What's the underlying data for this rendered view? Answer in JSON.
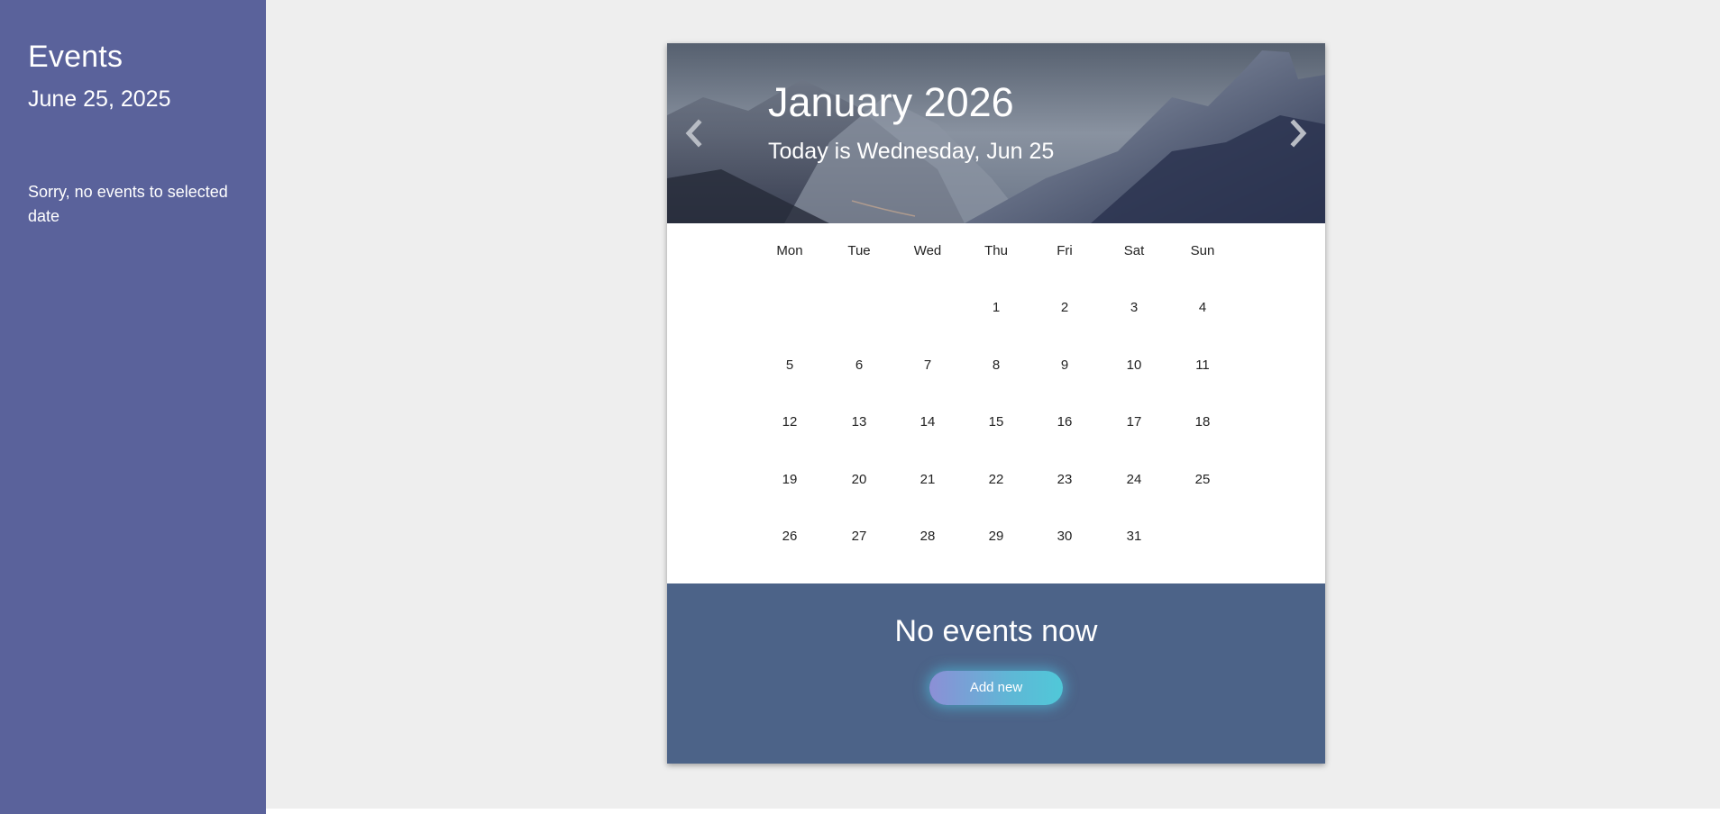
{
  "sidebar": {
    "title": "Events",
    "date": "June 25, 2025",
    "message": "Sorry, no events to selected date"
  },
  "calendar": {
    "month_title": "January 2026",
    "today_text": "Today is Wednesday, Jun 25",
    "weekdays": [
      "Mon",
      "Tue",
      "Wed",
      "Thu",
      "Fri",
      "Sat",
      "Sun"
    ],
    "weeks": [
      [
        "",
        "",
        "",
        "1",
        "2",
        "3",
        "4"
      ],
      [
        "5",
        "6",
        "7",
        "8",
        "9",
        "10",
        "11"
      ],
      [
        "12",
        "13",
        "14",
        "15",
        "16",
        "17",
        "18"
      ],
      [
        "19",
        "20",
        "21",
        "22",
        "23",
        "24",
        "25"
      ],
      [
        "26",
        "27",
        "28",
        "29",
        "30",
        "31",
        ""
      ]
    ],
    "prev_icon": "chevron-left-icon",
    "next_icon": "chevron-right-icon"
  },
  "events_panel": {
    "title": "No events now",
    "add_button": "Add new"
  },
  "colors": {
    "sidebar_bg": "#5a629b",
    "events_bg": "#4c6388",
    "page_bg": "#eeeeee",
    "button_gradient_start": "#8c8fd6",
    "button_gradient_end": "#50c8d8"
  }
}
